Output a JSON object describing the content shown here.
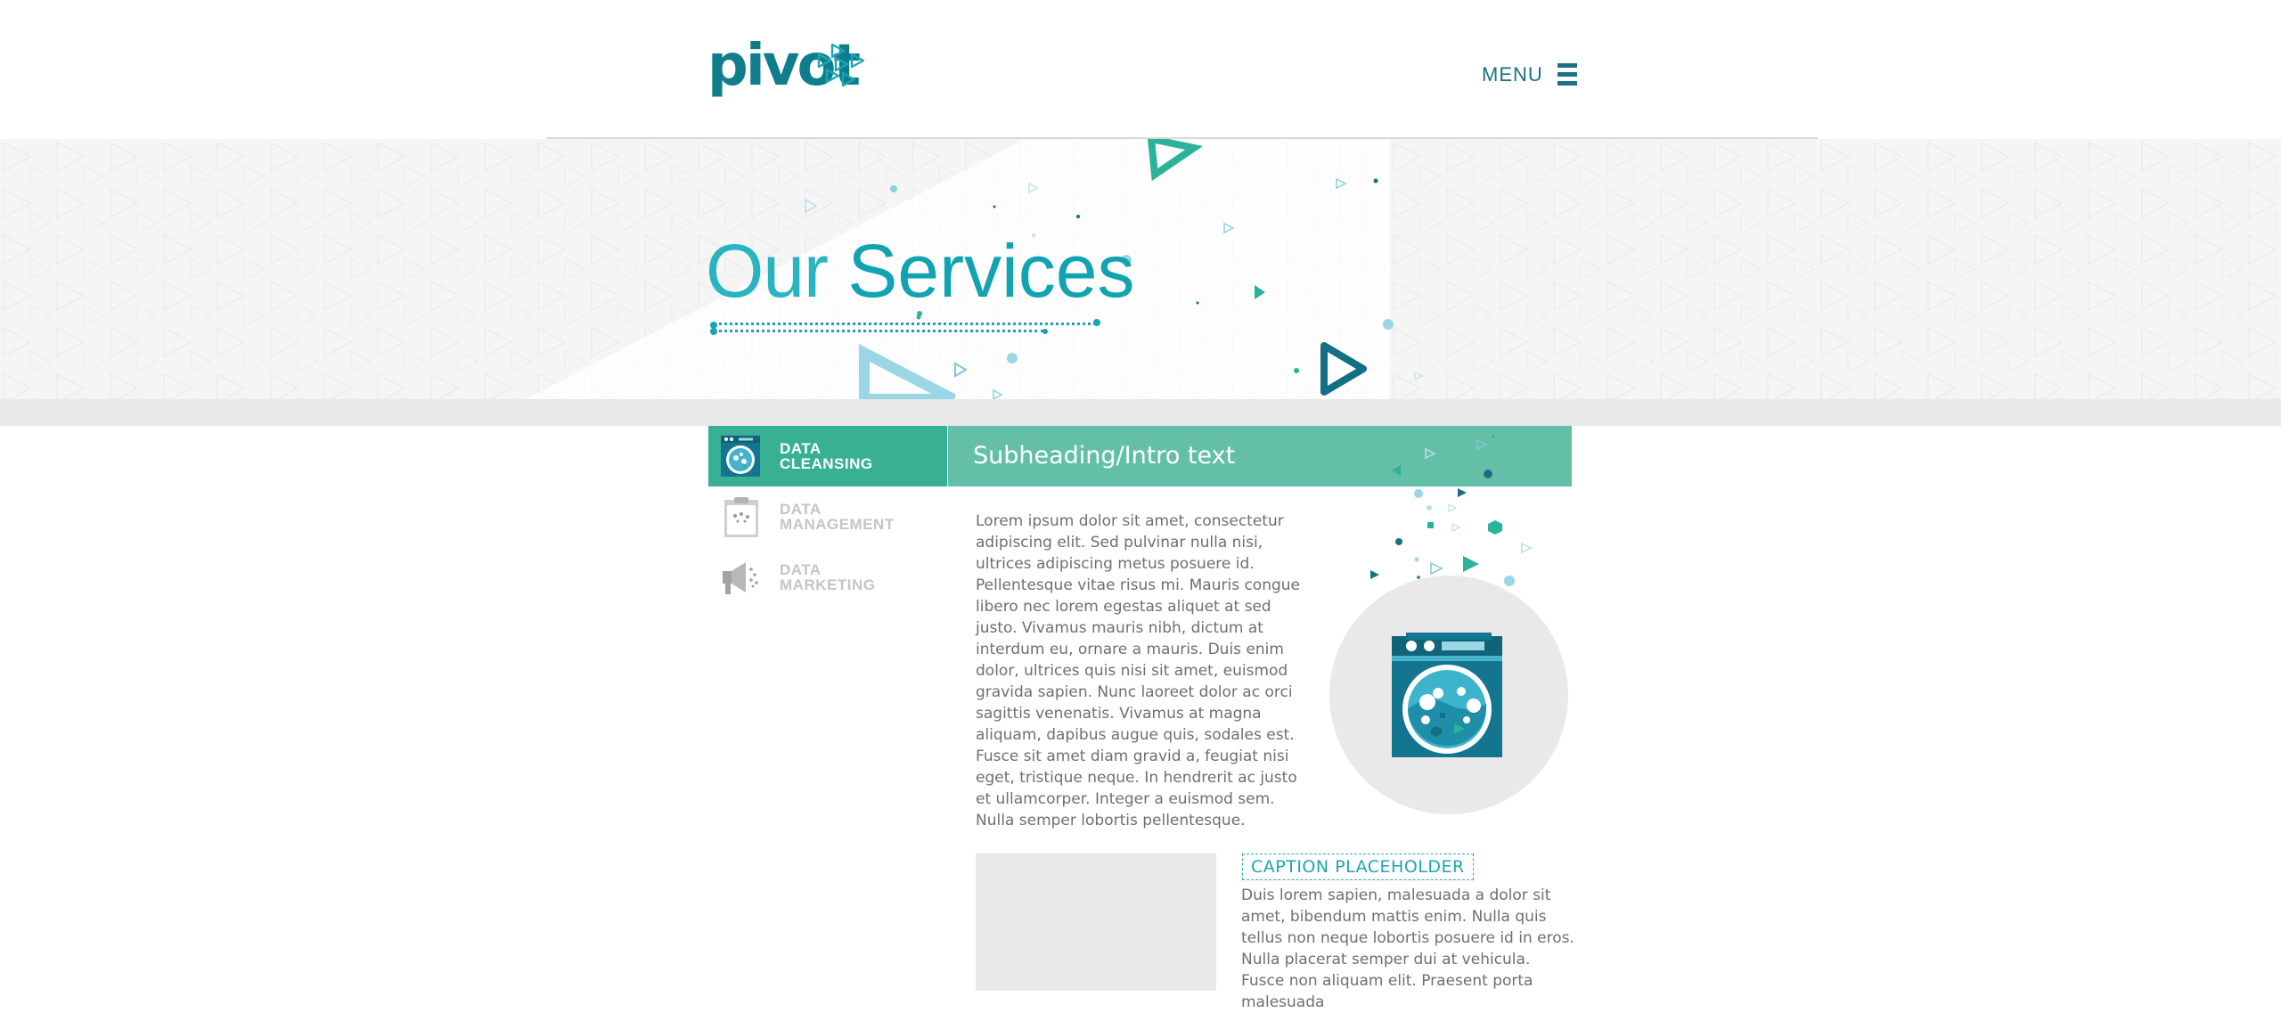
{
  "header": {
    "logo_text": "pivot",
    "menu_label": "MENU"
  },
  "hero": {
    "title_light": "Our ",
    "title_bold": "Services"
  },
  "sidebar": {
    "items": [
      {
        "label": "DATA\nCLEANSING",
        "active": true
      },
      {
        "label": "DATA\nMANAGEMENT",
        "active": false
      },
      {
        "label": "DATA\nMARKETING",
        "active": false
      }
    ]
  },
  "content": {
    "subheading": "Subheading/Intro text",
    "body": "Lorem ipsum dolor sit amet, consectetur adipiscing elit. Sed pulvinar nulla nisi, ultrices adipiscing metus posuere id. Pellentesque vitae risus mi. Mauris congue libero nec lorem egestas aliquet at sed justo. Vivamus mauris nibh, dictum at interdum eu, ornare a mauris. Duis enim dolor, ultrices quis nisi sit amet, euismod gravida sapien. Nunc laoreet dolor ac orci sagittis venenatis. Vivamus at magna aliquam, dapibus augue quis, sodales est. Fusce sit amet diam gravid a, feugiat nisi eget, tristique neque. In hendrerit ac justo et ullamcorper. Integer a euismod sem. Nulla semper lobortis pellentesque.",
    "caption": "CAPTION PLACEHOLDER",
    "caption_body": "Duis lorem sapien, malesuada a dolor sit amet, bibendum mattis enim. Nulla quis tellus non neque lobortis posuere id in eros. Nulla placerat semper dui at vehicula. Fusce non aliquam elit. Praesent porta malesuada"
  },
  "colors": {
    "brand_teal": "#12a3b2",
    "logo_teal": "#0f7d8c",
    "active_green": "#37b093",
    "subheading_green": "#63c0a6",
    "menu_blue": "#1d6f86"
  },
  "icons": {
    "logo": "pivot-logo-triangles",
    "menu": "hamburger-icon",
    "cleansing": "washing-machine-icon",
    "management": "clipboard-icon",
    "marketing": "megaphone-icon"
  }
}
